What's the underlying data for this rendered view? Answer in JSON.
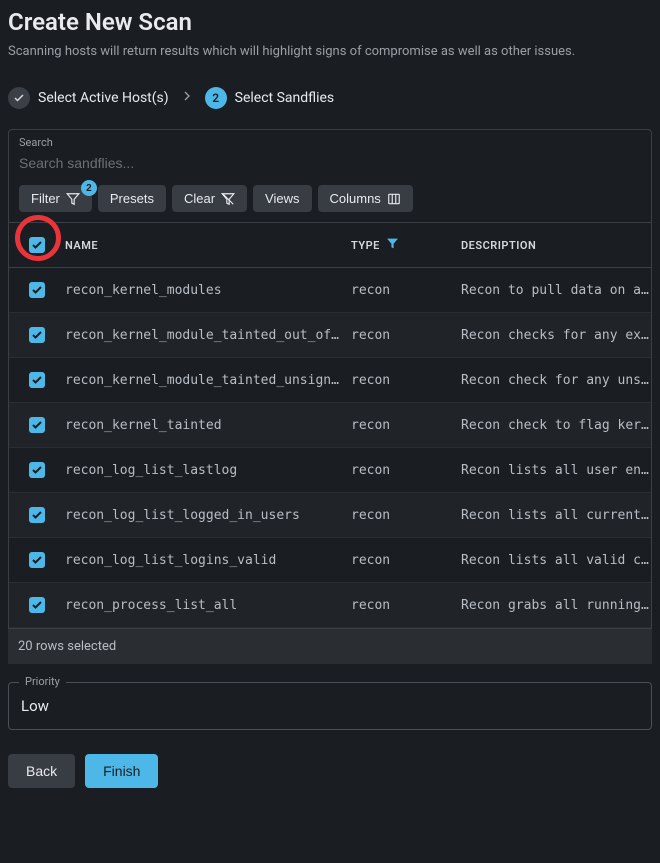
{
  "header": {
    "title": "Create New Scan",
    "subtitle": "Scanning hosts will return results which will highlight signs of compromise as well as other issues."
  },
  "stepper": {
    "step1": {
      "label": "Select Active Host(s)"
    },
    "step2": {
      "number": "2",
      "label": "Select Sandflies"
    }
  },
  "search": {
    "label": "Search",
    "placeholder": "Search sandflies..."
  },
  "toolbar": {
    "filter": "Filter",
    "filter_badge": "2",
    "presets": "Presets",
    "clear": "Clear",
    "views": "Views",
    "columns": "Columns"
  },
  "columns": {
    "name": "NAME",
    "type": "TYPE",
    "description": "DESCRIPTION"
  },
  "rows": [
    {
      "name": "recon_kernel_modules",
      "type": "recon",
      "desc": "Recon to pull data on all "
    },
    {
      "name": "recon_kernel_module_tainted_out_of…",
      "type": "recon",
      "desc": "Recon checks for any exter"
    },
    {
      "name": "recon_kernel_module_tainted_unsign…",
      "type": "recon",
      "desc": "Recon check for any unsign"
    },
    {
      "name": "recon_kernel_tainted",
      "type": "recon",
      "desc": "Recon check to flag kernel"
    },
    {
      "name": "recon_log_list_lastlog",
      "type": "recon",
      "desc": "Recon lists all user entri"
    },
    {
      "name": "recon_log_list_logged_in_users",
      "type": "recon",
      "desc": "Recon lists all currently "
    },
    {
      "name": "recon_log_list_logins_valid",
      "type": "recon",
      "desc": "Recon lists all valid curr"
    },
    {
      "name": "recon_process_list_all",
      "type": "recon",
      "desc": "Recon grabs all running pr"
    }
  ],
  "footer": {
    "selected": "20 rows selected"
  },
  "priority": {
    "label": "Priority",
    "value": "Low"
  },
  "actions": {
    "back": "Back",
    "finish": "Finish"
  }
}
